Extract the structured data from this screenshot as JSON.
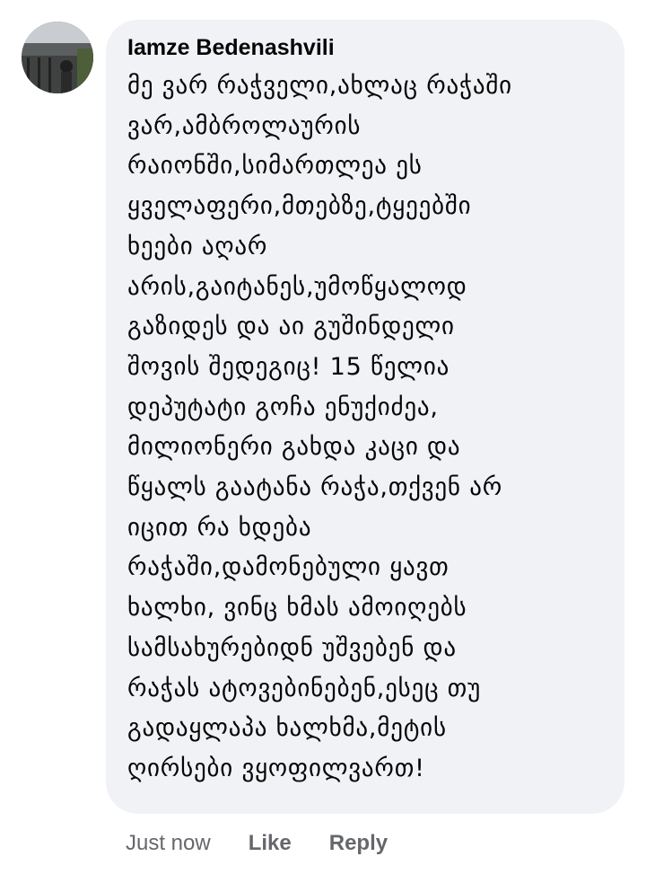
{
  "comment": {
    "author": "Iamze Bedenashvili",
    "text_lines": [
      "მე ვარ რაჭველი,ახლაც რაჭაში",
      "ვარ,ამბროლაურის",
      "რაიონში,სიმართლეა ეს",
      "ყველაფერი,მთებზე,ტყეებში",
      "ხეები აღარ",
      "არის,გაიტანეს,უმოწყალოდ",
      "გაზიდეს და აი გუშინდელი",
      "შოვის შედეგიც! 15 წელია",
      "დეპუტატი გოჩა ენუქიძეა,",
      "მილიონერი გახდა კაცი და",
      "წყალს გაატანა რაჭა,თქვენ არ",
      "იცით რა ხდება",
      "რაჭაში,დამონებული ყავთ",
      "ხალხი, ვინც ხმას ამოიღებს",
      "სამსახურებიდნ უშვებენ და",
      "რაჭას ატოვებინებენ,ესეც თუ",
      "გადაყლაპა ხალხმა,მეტის",
      "ღირსები ვყოფილვართ!"
    ]
  },
  "actions": {
    "timestamp": "Just now",
    "like_label": "Like",
    "reply_label": "Reply"
  },
  "colors": {
    "bubble_background": "#f0f2f5",
    "text": "#050505",
    "secondary_text": "#65676b"
  }
}
